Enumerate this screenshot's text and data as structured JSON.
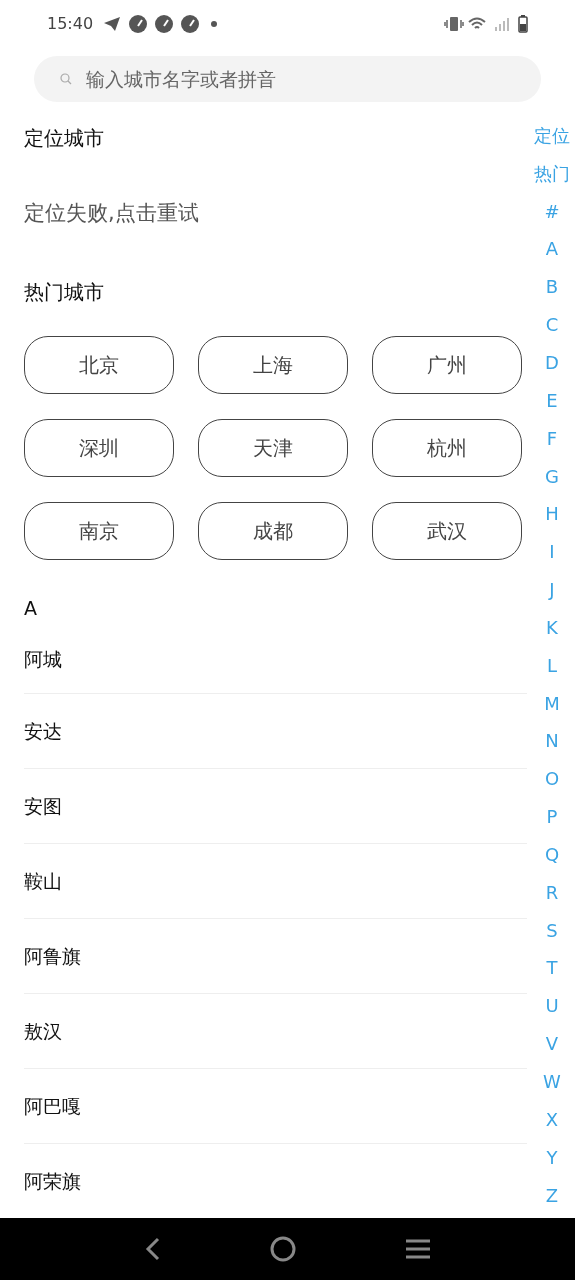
{
  "status_bar": {
    "time": "15:40"
  },
  "search": {
    "placeholder": "输入城市名字或者拼音"
  },
  "location": {
    "title": "定位城市",
    "message": "定位失败,点击重试"
  },
  "hot": {
    "title": "热门城市",
    "cities": [
      "北京",
      "上海",
      "广州",
      "深圳",
      "天津",
      "杭州",
      "南京",
      "成都",
      "武汉"
    ]
  },
  "sections": [
    {
      "letter": "A",
      "cities": [
        "阿城",
        "安达",
        "安图",
        "鞍山",
        "阿鲁旗",
        "敖汉",
        "阿巴嘎",
        "阿荣旗"
      ]
    }
  ],
  "index_bar": [
    "定位",
    "热门",
    "#",
    "A",
    "B",
    "C",
    "D",
    "E",
    "F",
    "G",
    "H",
    "I",
    "J",
    "K",
    "L",
    "M",
    "N",
    "O",
    "P",
    "Q",
    "R",
    "S",
    "T",
    "U",
    "V",
    "W",
    "X",
    "Y",
    "Z"
  ]
}
